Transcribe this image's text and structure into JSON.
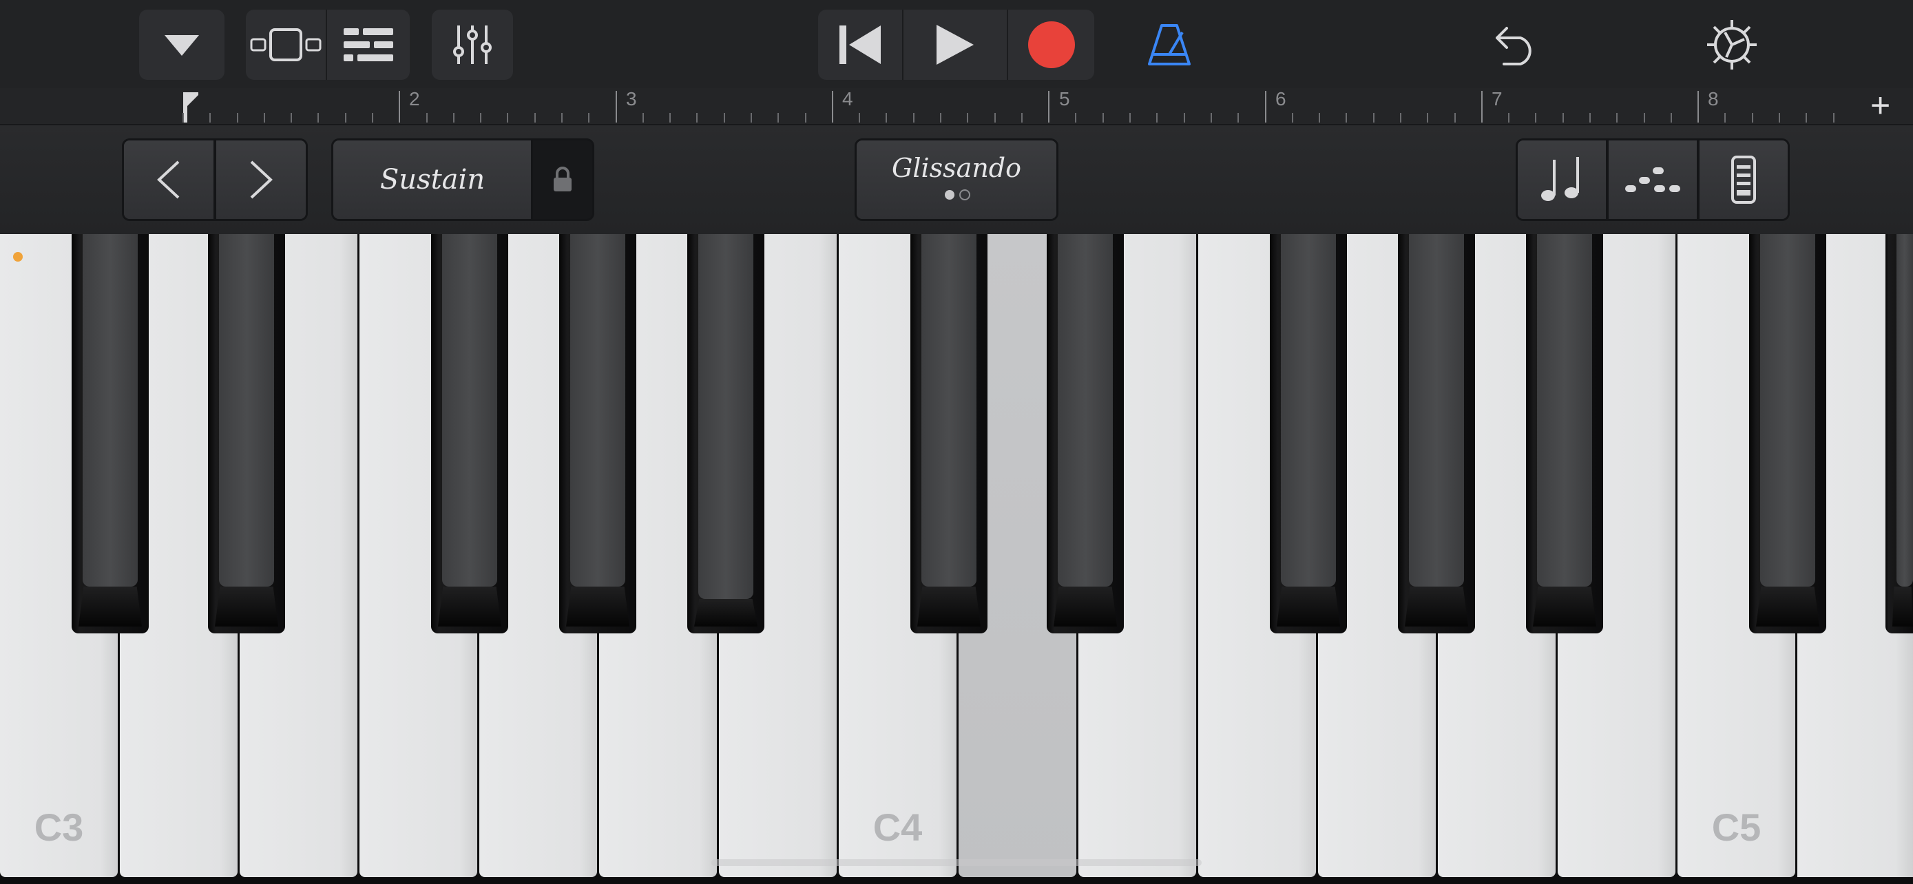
{
  "toolbar": {
    "buttons": [
      {
        "name": "browser-dropdown-icon"
      },
      {
        "name": "instrument-view-icon"
      },
      {
        "name": "tracks-view-icon"
      },
      {
        "name": "mixer-icon"
      },
      {
        "name": "go-to-beginning-icon"
      },
      {
        "name": "play-icon"
      },
      {
        "name": "record-icon"
      },
      {
        "name": "metronome-icon"
      },
      {
        "name": "undo-icon"
      },
      {
        "name": "settings-icon"
      }
    ],
    "record_color": "#e8423a",
    "metronome_color": "#3a86f5"
  },
  "ruler": {
    "bars": [
      "2",
      "3",
      "4",
      "5",
      "6",
      "7",
      "8"
    ],
    "add_label": "+"
  },
  "controls": {
    "octave_down_icon": "chevron-left-icon",
    "octave_up_icon": "chevron-right-icon",
    "sustain_label": "Sustain",
    "sustain_lock_icon": "lock-icon",
    "glissando_label": "Glissando",
    "right_buttons": [
      "notes-icon",
      "arpeggiator-icon",
      "keyboard-settings-icon"
    ]
  },
  "keyboard": {
    "note_labels": {
      "c3": "C3",
      "c4": "C4",
      "c5": "C5"
    },
    "pressed_key": "D4"
  }
}
